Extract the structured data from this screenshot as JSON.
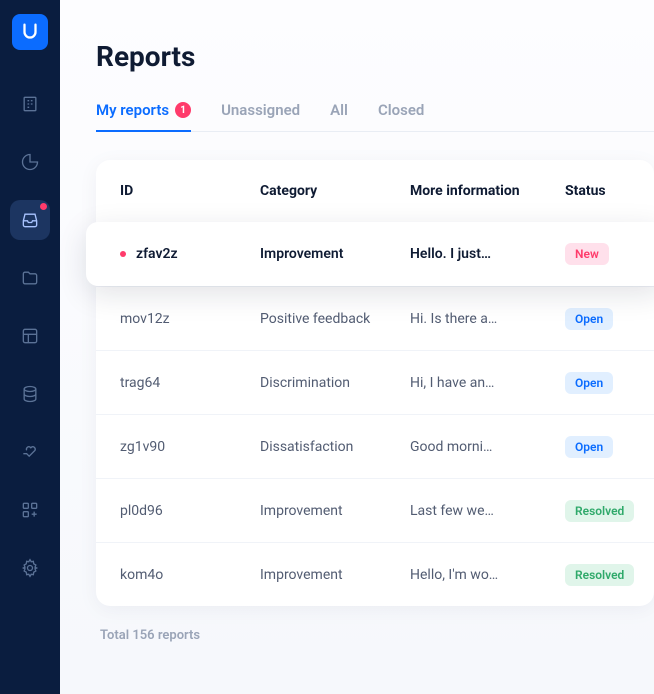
{
  "page": {
    "title": "Reports",
    "total": "Total 156 reports"
  },
  "tabs": [
    {
      "label": "My reports",
      "badge": "1"
    },
    {
      "label": "Unassigned"
    },
    {
      "label": "All"
    },
    {
      "label": "Closed"
    }
  ],
  "columns": {
    "id": "ID",
    "category": "Category",
    "info": "More information",
    "status": "Status"
  },
  "rows": [
    {
      "id": "zfav2z",
      "category": "Improvement",
      "info": "Hello. I just…",
      "status": "New",
      "status_class": "new",
      "highlight": true,
      "dot": true
    },
    {
      "id": "mov12z",
      "category": "Positive feedback",
      "info": "Hi. Is there a…",
      "status": "Open",
      "status_class": "open"
    },
    {
      "id": "trag64",
      "category": "Discrimination",
      "info": "Hi, I have an…",
      "status": "Open",
      "status_class": "open"
    },
    {
      "id": "zg1v90",
      "category": "Dissatisfaction",
      "info": "Good morni…",
      "status": "Open",
      "status_class": "open"
    },
    {
      "id": "pl0d96",
      "category": "Improvement",
      "info": "Last few we…",
      "status": "Resolved",
      "status_class": "resolved"
    },
    {
      "id": "kom4o",
      "category": "Improvement",
      "info": "Hello, I'm wo…",
      "status": "Resolved",
      "status_class": "resolved"
    }
  ]
}
